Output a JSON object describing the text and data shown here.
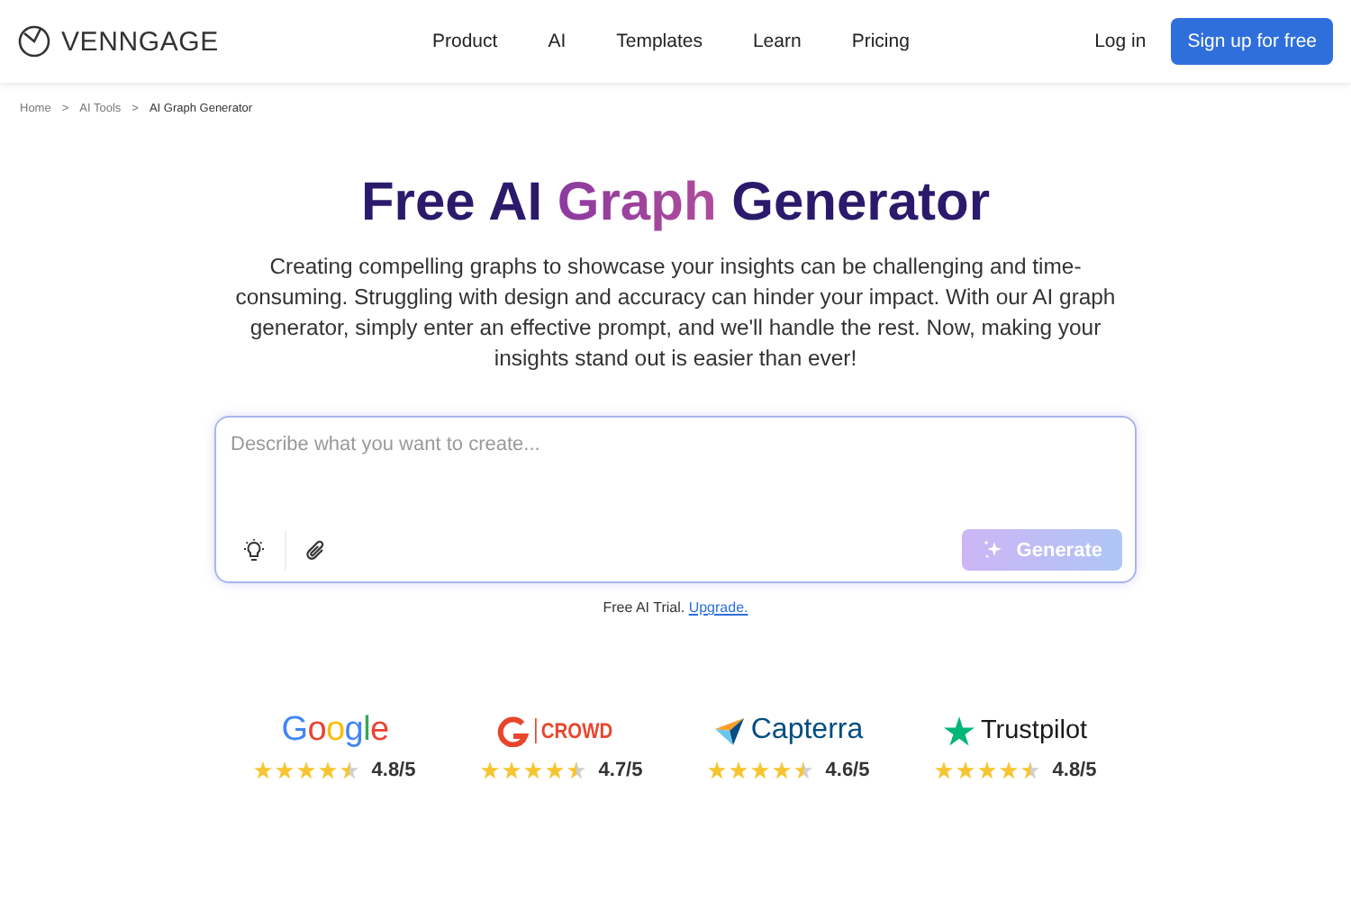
{
  "header": {
    "logo": "VENNGAGE",
    "nav": [
      {
        "label": "Product"
      },
      {
        "label": "AI"
      },
      {
        "label": "Templates"
      },
      {
        "label": "Learn"
      },
      {
        "label": "Pricing"
      }
    ],
    "login": "Log in",
    "signup": "Sign up for free"
  },
  "breadcrumbs": [
    "Home",
    "AI Tools",
    "AI Graph Generator"
  ],
  "breadcrumb_separator": ">",
  "hero": {
    "title_before": "Free AI",
    "title_highlight": "Graph",
    "title_after": "Generator",
    "description": "Creating compelling graphs to showcase your insights can be challenging and time-consuming. Struggling with design and accuracy can hinder your impact. With our AI graph generator, simply enter an effective prompt, and we'll handle the rest. Now, making your insights stand out is easier than ever!"
  },
  "prompt": {
    "placeholder": "Describe what you want to create...",
    "generate": "Generate",
    "generate_disabled": true,
    "trial_note": "Free AI Trial.",
    "upgrade_link": "Upgrade."
  },
  "ratings": [
    {
      "kind": "google",
      "brand": "Google",
      "stars": 4.5,
      "score": "4.8/5"
    },
    {
      "kind": "g2",
      "brand": "CROWD",
      "stars": 4.5,
      "score": "4.7/5"
    },
    {
      "kind": "capterra",
      "brand": "Capterra",
      "stars": 4.5,
      "score": "4.6/5"
    },
    {
      "kind": "trustpilot",
      "brand": "Trustpilot",
      "stars": 4.5,
      "score": "4.8/5"
    }
  ]
}
